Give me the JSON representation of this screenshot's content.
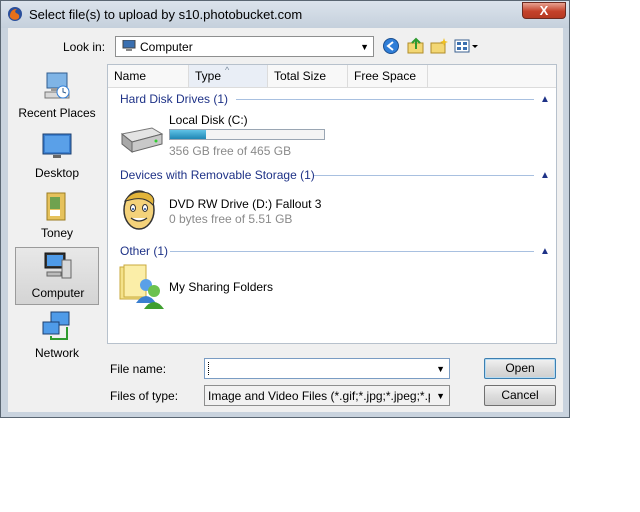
{
  "window": {
    "title": "Select file(s) to upload by s10.photobucket.com",
    "close_label": "X"
  },
  "lookin": {
    "label": "Look in:",
    "value": "Computer"
  },
  "toolbar": {
    "icons": [
      "back-icon",
      "up-folder-icon",
      "new-folder-icon",
      "views-icon"
    ]
  },
  "places": [
    {
      "label": "Recent Places",
      "icon": "recent-places-icon"
    },
    {
      "label": "Desktop",
      "icon": "desktop-icon"
    },
    {
      "label": "Toney",
      "icon": "user-folder-icon"
    },
    {
      "label": "Computer",
      "icon": "computer-icon",
      "selected": true
    },
    {
      "label": "Network",
      "icon": "network-icon"
    }
  ],
  "columns": [
    "Name",
    "Type",
    "Total Size",
    "Free Space"
  ],
  "groups": {
    "hdd": {
      "title": "Hard Disk Drives (1)"
    },
    "removable": {
      "title": "Devices with Removable Storage (1)"
    },
    "other": {
      "title": "Other (1)"
    }
  },
  "items": {
    "local_disk": {
      "name": "Local Disk (C:)",
      "detail": "356 GB free of 465 GB",
      "used_fraction": 0.234
    },
    "dvd": {
      "name": "DVD RW Drive (D:) Fallout 3",
      "detail": "0 bytes free of 5.51 GB"
    },
    "sharing": {
      "name": "My Sharing Folders"
    }
  },
  "filename": {
    "label": "File name:",
    "value": ""
  },
  "filetype": {
    "label": "Files of type:",
    "value": "Image and Video Files (*.gif;*.jpg;*.jpeg;*.png;*.b"
  },
  "buttons": {
    "open": "Open",
    "cancel": "Cancel"
  }
}
